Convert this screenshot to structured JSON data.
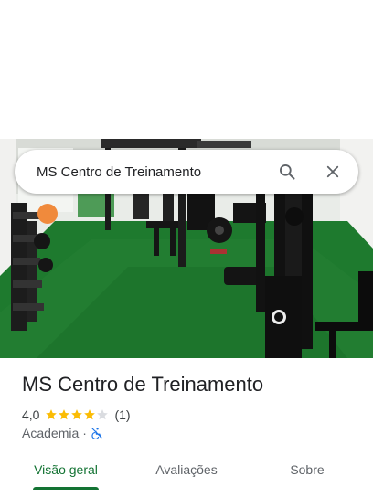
{
  "search": {
    "query": "MS Centro de Treinamento",
    "search_icon": "search-icon",
    "close_icon": "close-icon"
  },
  "hero": {
    "image": "gym-interior-photo"
  },
  "place": {
    "name": "MS Centro de Treinamento",
    "rating": "4,0",
    "rating_value": 4,
    "stars_max": 5,
    "review_count": "(1)",
    "category": "Academia",
    "separator": "·",
    "accessibility_icon": "wheelchair-not-accessible-icon"
  },
  "tabs": [
    {
      "label": "Visão geral",
      "selected": true
    },
    {
      "label": "Avaliações",
      "selected": false
    },
    {
      "label": "Sobre",
      "selected": false
    }
  ],
  "colors": {
    "accent": "#137333",
    "star": "#fbbc04",
    "star_empty": "#dadce0",
    "access_icon": "#1a73e8",
    "turf": "#1e7a2e"
  }
}
